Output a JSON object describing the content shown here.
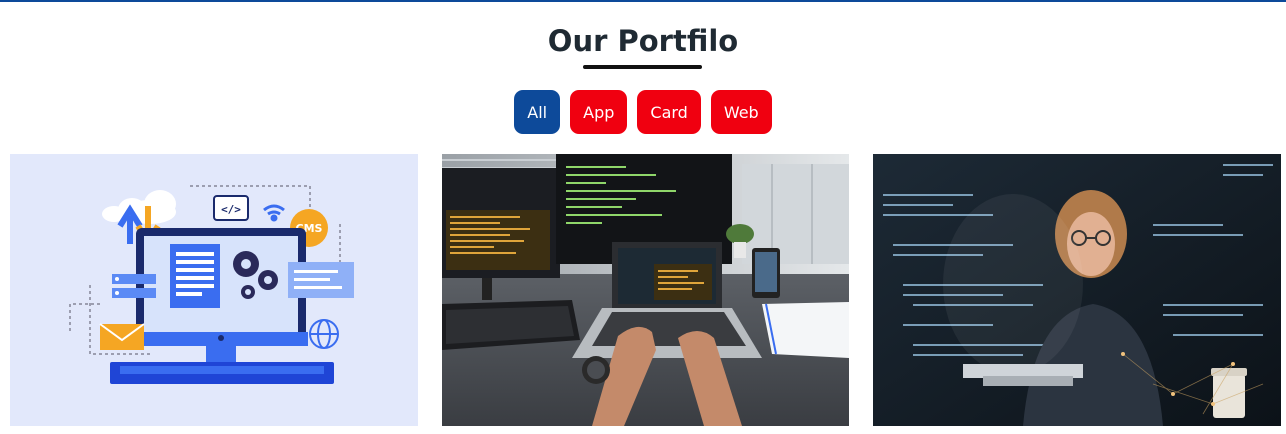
{
  "header": {
    "title": "Our Portfilo"
  },
  "filters": [
    {
      "label": "All",
      "active": true
    },
    {
      "label": "App",
      "active": false
    },
    {
      "label": "Card",
      "active": false
    },
    {
      "label": "Web",
      "active": false
    }
  ],
  "colors": {
    "accent_active": "#0d4a9a",
    "accent_inactive": "#f00010",
    "top_border": "#0d4a9a"
  },
  "gallery": {
    "items": [
      {
        "image": "web-development-illustration",
        "badge": "CMS",
        "code_icon": "</>"
      },
      {
        "image": "developer-laptop-photo"
      },
      {
        "image": "woman-coding-night-photo"
      }
    ]
  }
}
